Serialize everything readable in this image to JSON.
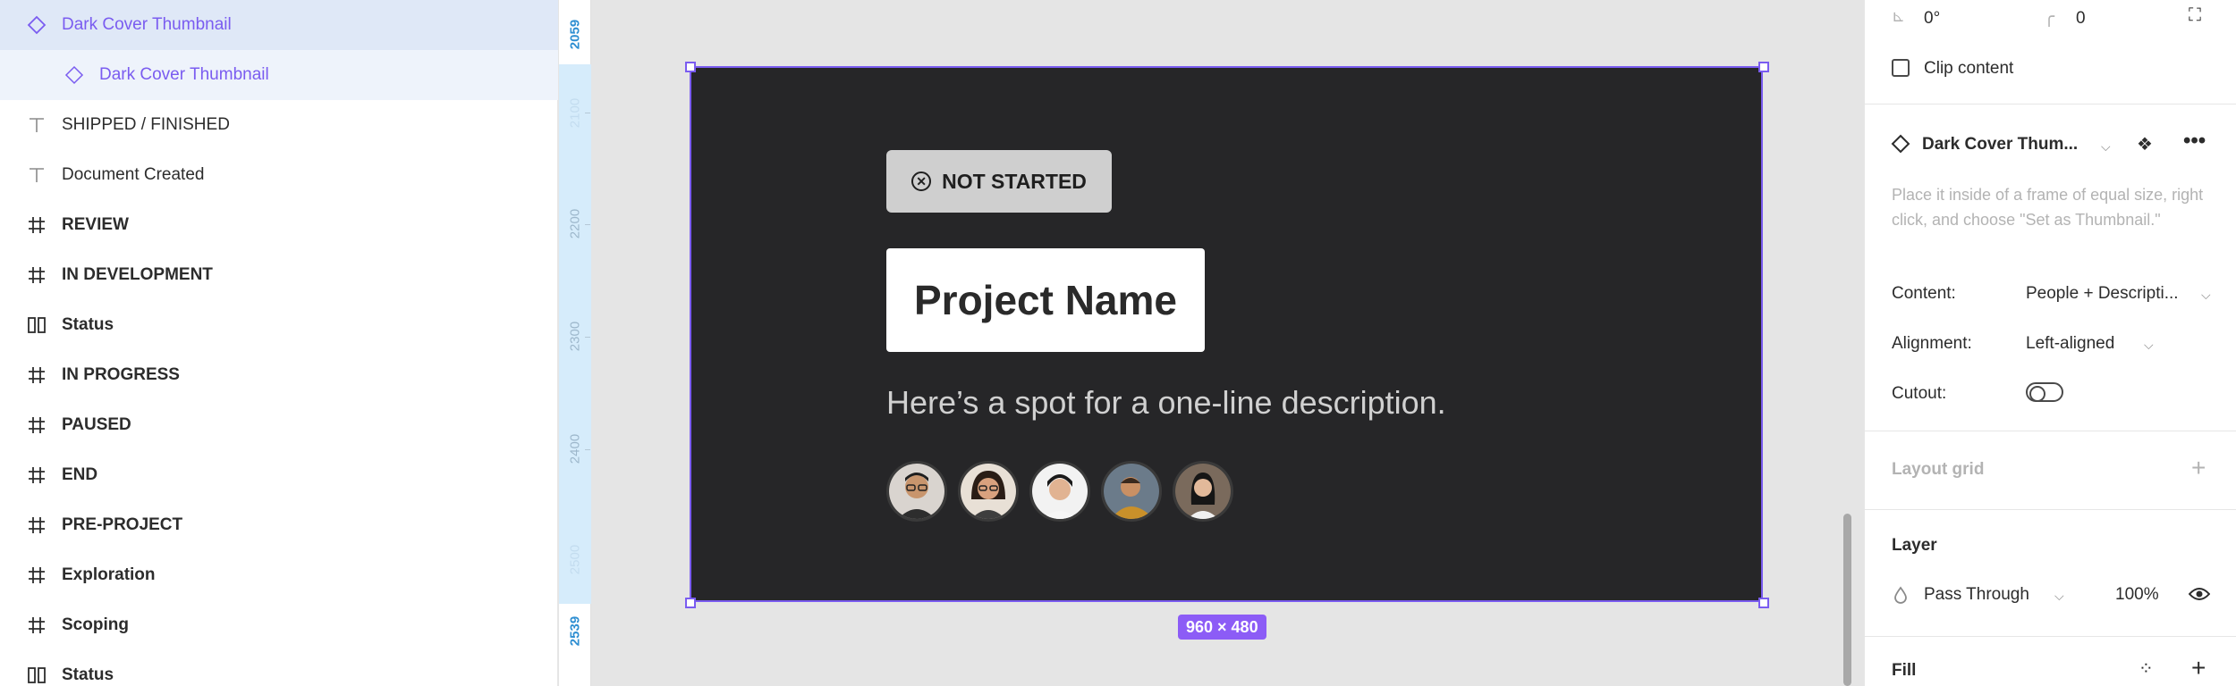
{
  "layers": [
    {
      "label": "Dark Cover Thumbnail",
      "icon": "component-icon",
      "state": "selected"
    },
    {
      "label": "Dark Cover Thumbnail",
      "icon": "component-instance-icon",
      "state": "child-selected"
    },
    {
      "label": "SHIPPED / FINISHED",
      "icon": "text-icon",
      "state": "normal"
    },
    {
      "label": "Document Created",
      "icon": "text-icon",
      "state": "normal"
    },
    {
      "label": "REVIEW",
      "icon": "frame-icon",
      "state": "bold"
    },
    {
      "label": "IN DEVELOPMENT",
      "icon": "frame-icon",
      "state": "bold"
    },
    {
      "label": "Status",
      "icon": "columns-icon",
      "state": "bold"
    },
    {
      "label": "IN PROGRESS",
      "icon": "frame-icon",
      "state": "bold"
    },
    {
      "label": "PAUSED",
      "icon": "frame-icon",
      "state": "bold"
    },
    {
      "label": "END",
      "icon": "frame-icon",
      "state": "bold"
    },
    {
      "label": "PRE-PROJECT",
      "icon": "frame-icon",
      "state": "bold"
    },
    {
      "label": "Exploration",
      "icon": "frame-icon",
      "state": "bold"
    },
    {
      "label": "Scoping",
      "icon": "frame-icon",
      "state": "bold"
    },
    {
      "label": "Status",
      "icon": "columns-icon",
      "state": "bold"
    }
  ],
  "ruler": {
    "labels": [
      "2059",
      "2100",
      "2200",
      "2300",
      "2400",
      "2500",
      "2539"
    ]
  },
  "canvas": {
    "status_pill": "NOT STARTED",
    "project_name": "Project Name",
    "description": "Here’s a spot for a one-line description.",
    "avatars": [
      "avatar-1",
      "avatar-2",
      "avatar-3",
      "avatar-4",
      "avatar-5"
    ],
    "size_badge": "960 × 480",
    "accent_color": "#7a5cf0",
    "frame_color": "#262628"
  },
  "props": {
    "rotation": "0°",
    "corner_radius": "0",
    "clip_content": "Clip content",
    "component_name": "Dark Cover Thum...",
    "hint": "Place it inside of a frame of equal size, right click, and choose \"Set as Thumbnail.\"",
    "content_label": "Content:",
    "content_value": "People + Descripti...",
    "alignment_label": "Alignment:",
    "alignment_value": "Left-aligned",
    "cutout_label": "Cutout:",
    "layout_grid": "Layout grid",
    "layer_title": "Layer",
    "blend_mode": "Pass Through",
    "opacity": "100%",
    "fill_title": "Fill"
  }
}
